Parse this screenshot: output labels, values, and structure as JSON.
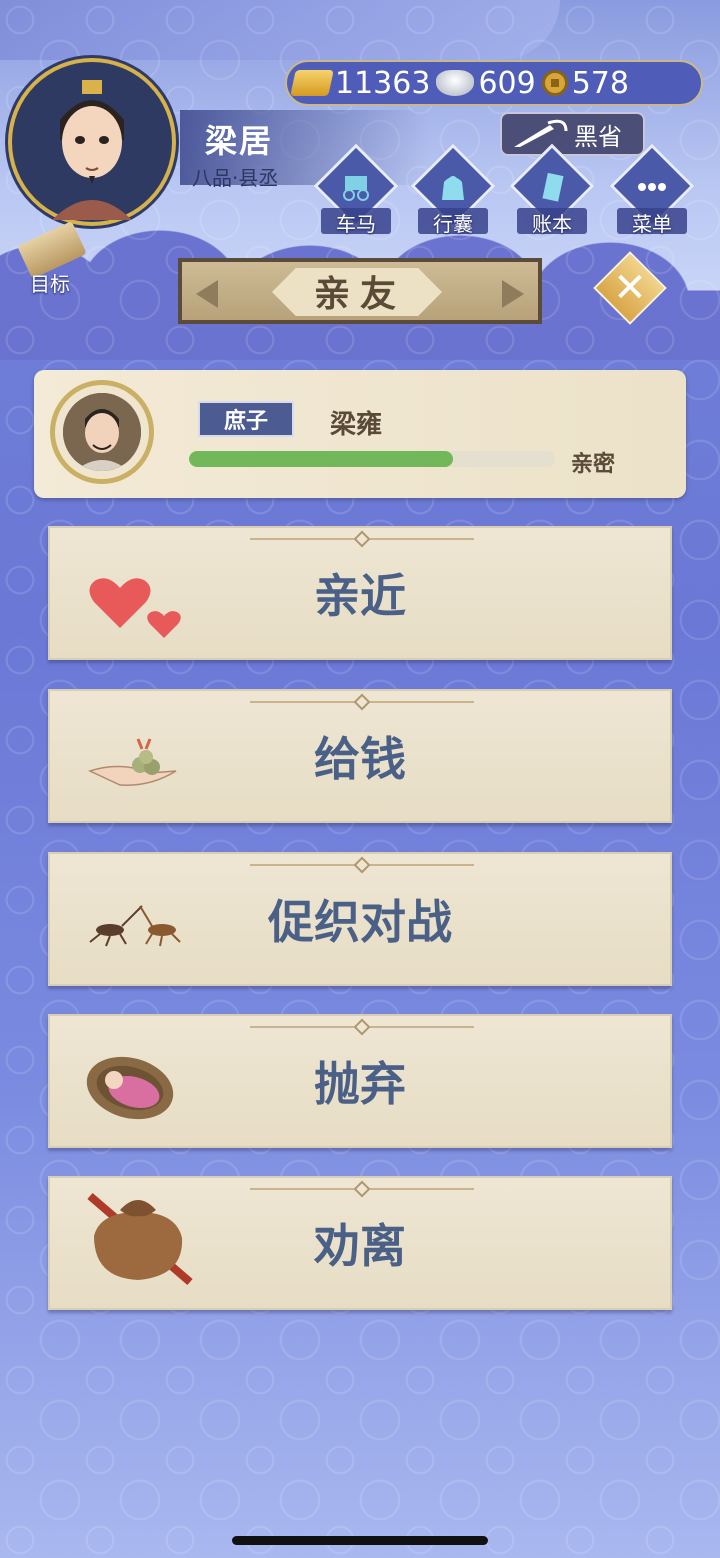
{
  "player": {
    "name": "梁居",
    "rank": "八品·县丞"
  },
  "currency": {
    "gold": "11363",
    "silver": "609",
    "coin": "578"
  },
  "heisheng": {
    "label": "黑省"
  },
  "menu": {
    "items": [
      {
        "label": "车马",
        "icon": "carriage-icon"
      },
      {
        "label": "行囊",
        "icon": "bag-icon"
      },
      {
        "label": "账本",
        "icon": "ledger-icon"
      },
      {
        "label": "菜单",
        "icon": "more-icon"
      }
    ]
  },
  "target": {
    "label": "目标"
  },
  "panel": {
    "title": "亲友"
  },
  "relative": {
    "tag": "庶子",
    "name": "梁雍",
    "intimacy_label": "亲密",
    "intimacy_fraction": 0.72
  },
  "actions": [
    {
      "label": "亲近",
      "icon": "hearts-icon"
    },
    {
      "label": "给钱",
      "icon": "money-hand-icon"
    },
    {
      "label": "促织对战",
      "icon": "cricket-icon"
    },
    {
      "label": "抛弃",
      "icon": "baby-basket-icon"
    },
    {
      "label": "劝离",
      "icon": "bundle-icon"
    }
  ],
  "colors": {
    "accent": "#4a6087",
    "background": "#6b78d6",
    "intimacy": "#72b85a"
  }
}
